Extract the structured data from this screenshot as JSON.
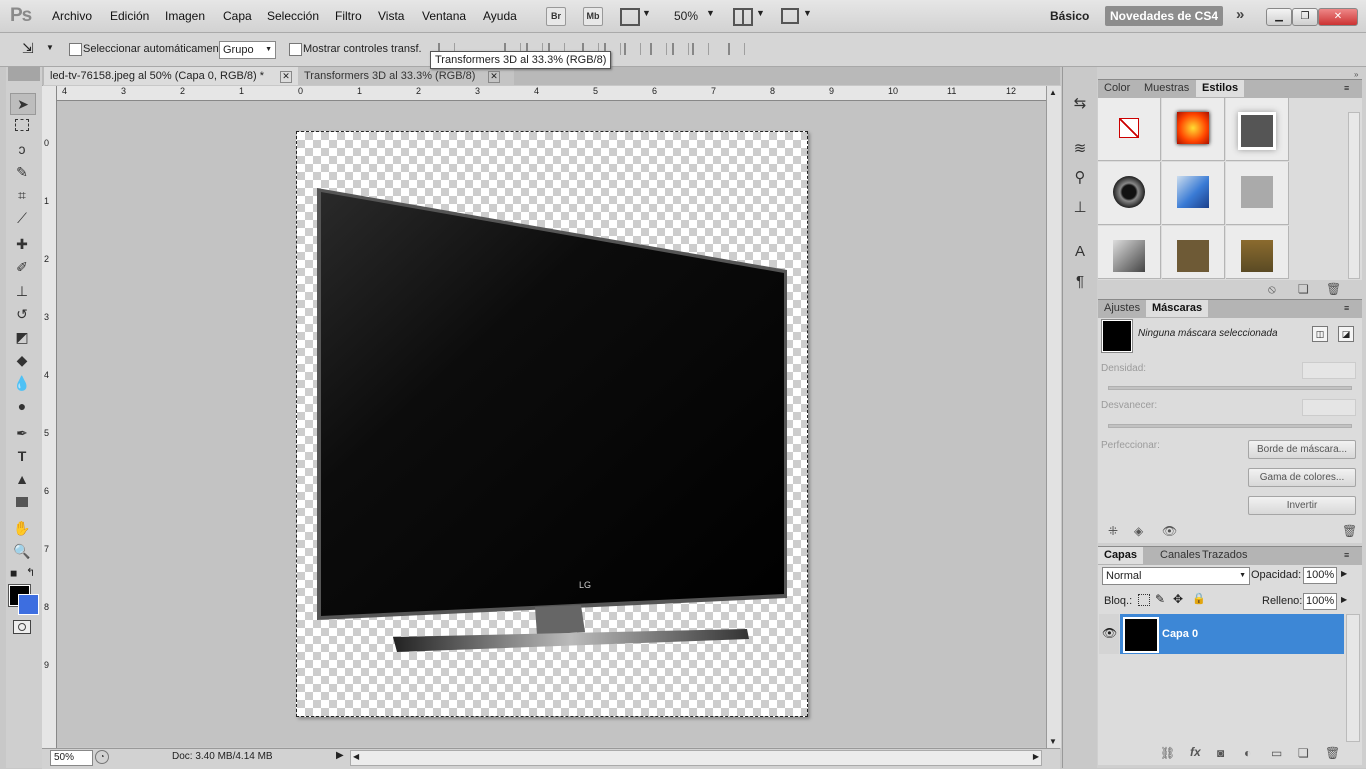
{
  "app": {
    "logo": "Ps"
  },
  "menu": [
    "Archivo",
    "Edición",
    "Imagen",
    "Capa",
    "Selección",
    "Filtro",
    "Vista",
    "Ventana",
    "Ayuda"
  ],
  "menubar_buttons": {
    "bridge": "Br",
    "mini_bridge": "Mb"
  },
  "zoom": "50%",
  "workspace": {
    "basic": "Básico",
    "cs4": "Novedades de CS4"
  },
  "options": {
    "auto_select_label": "Seleccionar automáticamente:",
    "auto_select_value": "Grupo",
    "show_transform_label": "Mostrar controles transf."
  },
  "tooltip": "Transformers 3D al 33.3% (RGB/8)",
  "tabs": [
    {
      "label": "led-tv-76158.jpeg al 50% (Capa 0, RGB/8) *",
      "active": true
    },
    {
      "label": "Transformers 3D al 33.3% (RGB/8)",
      "active": false
    }
  ],
  "ruler_top": [
    "4",
    "3",
    "2",
    "1",
    "0",
    "1",
    "2",
    "3",
    "4",
    "5",
    "6",
    "7",
    "8",
    "9",
    "10",
    "11",
    "12"
  ],
  "ruler_left": [
    "0",
    "1",
    "2",
    "3",
    "4",
    "5",
    "6",
    "7",
    "8",
    "9"
  ],
  "canvas": {
    "tv_brand": "LG"
  },
  "status": {
    "zoom": "50%",
    "doc": "Doc: 3.40 MB/4.14 MB"
  },
  "styles_panel": {
    "tabs": [
      "Color",
      "Muestras",
      "Estilos"
    ],
    "active": "Estilos"
  },
  "masks_panel": {
    "tabs": [
      "Ajustes",
      "Máscaras"
    ],
    "active": "Máscaras",
    "none_selected": "Ninguna máscara seleccionada",
    "density": "Densidad:",
    "feather": "Desvanecer:",
    "refine": "Perfeccionar:",
    "btn_edge": "Borde de máscara...",
    "btn_color": "Gama de colores...",
    "btn_invert": "Invertir"
  },
  "layers_panel": {
    "tabs": [
      "Capas",
      "Canales",
      "Trazados"
    ],
    "active": "Capas",
    "blend_mode": "Normal",
    "opacity_label": "Opacidad:",
    "opacity": "100%",
    "lock_label": "Bloq.:",
    "fill_label": "Relleno:",
    "fill": "100%",
    "layers": [
      {
        "name": "Capa 0",
        "visible": true,
        "selected": true
      }
    ]
  },
  "colors": {
    "foreground": "#000000",
    "background": "#3d6ee0",
    "layer_highlight": "#3d87d6",
    "workspace_active": "#8d8d8d"
  }
}
